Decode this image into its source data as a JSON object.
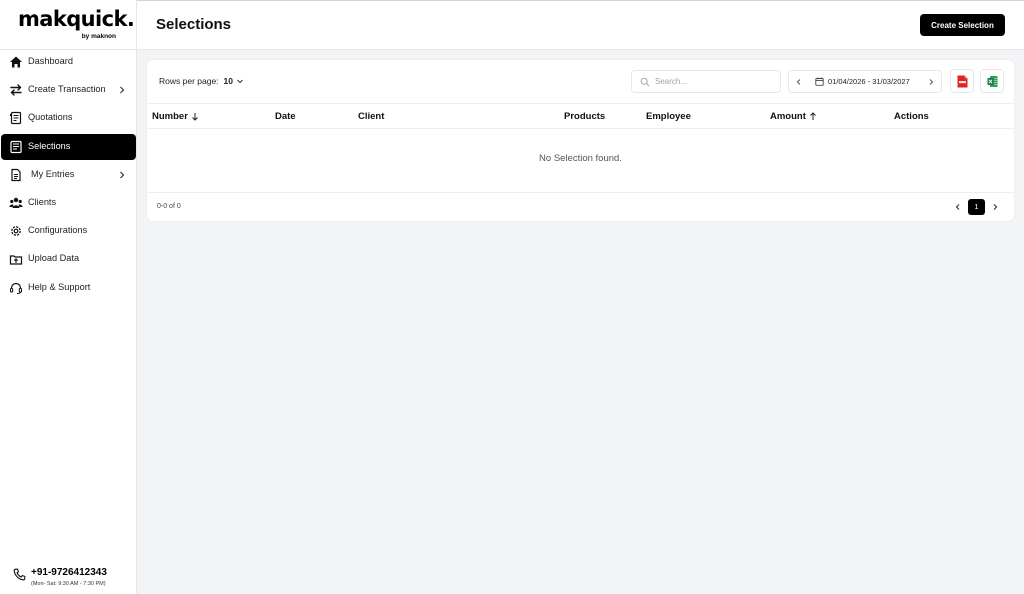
{
  "brand": {
    "name": "makquick.",
    "tagline": "by maknon"
  },
  "sidebar": {
    "items": [
      {
        "label": "Dashboard",
        "icon": "home-icon"
      },
      {
        "label": "Create Transaction",
        "icon": "transfer-icon",
        "has_submenu": true
      },
      {
        "label": "Quotations",
        "icon": "quotation-icon"
      },
      {
        "label": "Selections",
        "icon": "selection-icon",
        "active": true
      },
      {
        "label": "My Entries",
        "icon": "document-icon",
        "has_submenu": true
      },
      {
        "label": "Clients",
        "icon": "users-icon"
      },
      {
        "label": "Configurations",
        "icon": "gear-icon"
      },
      {
        "label": "Upload Data",
        "icon": "upload-icon"
      },
      {
        "label": "Help & Support",
        "icon": "headset-icon"
      }
    ],
    "support": {
      "phone": "+91-9726412343",
      "hours": "(Mon- Sat: 9:30 AM - 7:30 PM)"
    }
  },
  "header": {
    "title": "Selections",
    "create_button": "Create Selection"
  },
  "toolbar": {
    "rows_per_page_label": "Rows per page:",
    "rows_per_page_value": "10",
    "search_placeholder": "Search...",
    "date_range": "01/04/2026 - 31/03/2027",
    "export_pdf_icon": "pdf-icon",
    "export_excel_icon": "excel-icon"
  },
  "table": {
    "columns": [
      {
        "label": "Number",
        "sort": "desc"
      },
      {
        "label": "Date"
      },
      {
        "label": "Client"
      },
      {
        "label": "Products"
      },
      {
        "label": "Employee"
      },
      {
        "label": "Amount",
        "sort": "asc"
      },
      {
        "label": "Actions"
      }
    ],
    "empty_message": "No Selection found.",
    "rows": []
  },
  "pagination": {
    "summary": "0-0 of 0",
    "current_page": "1"
  },
  "colors": {
    "accent": "#000000",
    "background": "#f3f4f6",
    "pdf": "#e02424",
    "excel": "#1d7a45"
  }
}
